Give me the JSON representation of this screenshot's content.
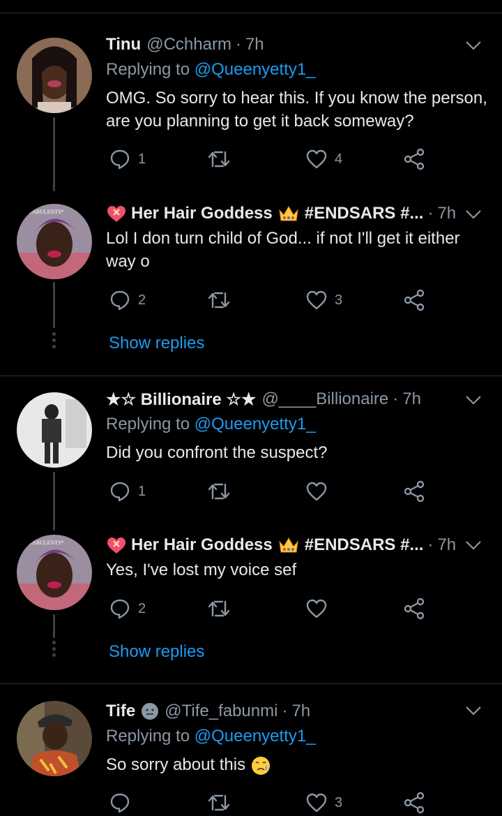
{
  "tweets": [
    {
      "name": "Tinu",
      "handle": "@Cchharm",
      "time": "7h",
      "replying_prefix": "Replying to",
      "replying_to": "@Queenyetty1_",
      "text": "OMG. So sorry to hear this. If you know the person, are you planning to get it back someway?",
      "reply_count": "1",
      "retweet_count": "",
      "like_count": "4"
    },
    {
      "name": "Her Hair Goddess",
      "hashtag": "#ENDSARS #...",
      "time": "7h",
      "text": "Lol I don turn child of God... if not I'll get it either way o",
      "reply_count": "2",
      "retweet_count": "",
      "like_count": "3",
      "show_replies": "Show replies"
    },
    {
      "name": "★☆ Billionaire ☆★",
      "handle": "@____Billionaire",
      "time": "7h",
      "replying_prefix": "Replying to",
      "replying_to": "@Queenyetty1_",
      "text": "Did you confront the suspect?",
      "reply_count": "1",
      "retweet_count": "",
      "like_count": ""
    },
    {
      "name": "Her Hair Goddess",
      "hashtag": "#ENDSARS #...",
      "time": "7h",
      "text": "Yes, I've lost my voice sef",
      "reply_count": "2",
      "retweet_count": "",
      "like_count": "",
      "show_replies": "Show replies"
    },
    {
      "name": "Tife",
      "handle": "@Tife_fabunmi",
      "time": "7h",
      "replying_prefix": "Replying to",
      "replying_to": "@Queenyetty1_",
      "text": "So sorry about this",
      "reply_count": "",
      "retweet_count": "",
      "like_count": "3"
    }
  ],
  "separator": "·",
  "colors": {
    "background": "#000000",
    "accent": "#1d9bf0",
    "muted": "#8b98a5",
    "text": "#e7e9ea"
  },
  "icons": [
    "reply-icon",
    "retweet-icon",
    "like-icon",
    "share-icon",
    "chevron-down-icon",
    "heart-ribbon-emoji",
    "crown-emoji",
    "face-emoji",
    "crying-emoji"
  ]
}
